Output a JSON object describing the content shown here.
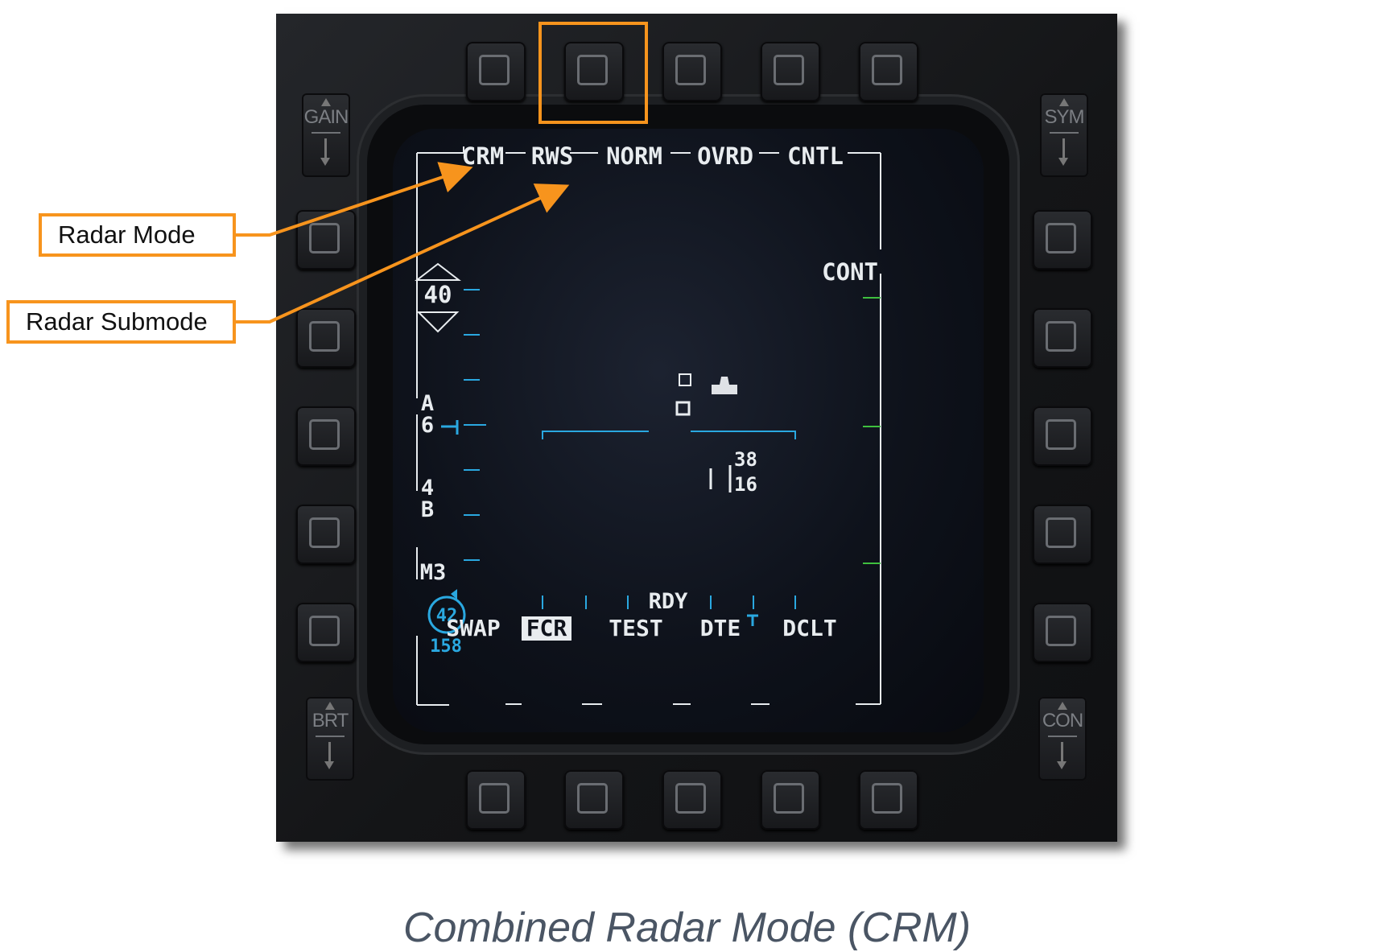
{
  "callouts": {
    "radar_mode": "Radar Mode",
    "radar_submode": "Radar Submode"
  },
  "caption": "Combined Radar Mode (CRM)",
  "bezel": {
    "gain_label": "GAIN",
    "sym_label": "SYM",
    "brt_label": "BRT",
    "con_label": "CON"
  },
  "top_menu": {
    "mode": "CRM",
    "submode": "RWS",
    "norm": "NORM",
    "ovrd": "OVRD",
    "cntl": "CNTL"
  },
  "right_menu": {
    "cont": "CONT"
  },
  "left_scale": {
    "range": "40",
    "azimuth_a": "A",
    "azimuth_val": "6",
    "bar_val": "4",
    "bar_b": "B",
    "master_mode": "M3",
    "circle_val": "42",
    "bottom_val": "158"
  },
  "center": {
    "top_number": "38",
    "bottom_number": "16"
  },
  "bottom_menu": {
    "status": "RDY",
    "swap": "SWAP",
    "fcr": "FCR",
    "test": "TEST",
    "dte": "DTE",
    "dclt": "DCLT"
  },
  "colors": {
    "highlight": "#f7941d",
    "symbology": "#e8ecef",
    "cyan": "#2aa8e0",
    "green": "#3fbf3f"
  }
}
